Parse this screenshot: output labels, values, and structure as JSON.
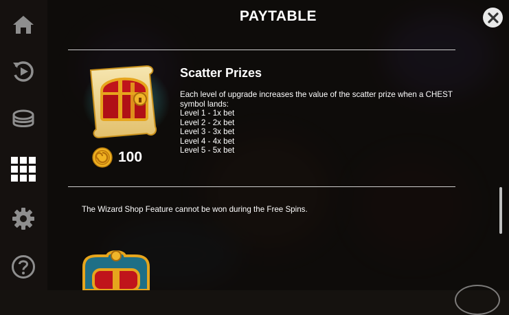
{
  "header": {
    "title": "PAYTABLE"
  },
  "sidebar": {
    "items": [
      {
        "icon": "home-icon"
      },
      {
        "icon": "autoplay-icon"
      },
      {
        "icon": "coin-stack-icon"
      },
      {
        "icon": "grid-icon",
        "active": true
      },
      {
        "icon": "gear-icon"
      },
      {
        "icon": "help-icon"
      }
    ]
  },
  "scatter": {
    "title": "Scatter Prizes",
    "description_lines": [
      "Each level of upgrade increases the value of the scatter prize when a CHEST",
      "symbol lands:",
      "Level 1 - 1x bet",
      "Level 2 - 2x bet",
      "Level 3 - 3x bet",
      "Level 4 - 4x bet",
      "Level 5 - 5x bet"
    ],
    "coin_value": "100"
  },
  "notes": {
    "wizard_shop": "The Wizard Shop Feature cannot be won during the Free Spins."
  },
  "colors": {
    "chest_red": "#c0141b",
    "gold": "#e6a51d",
    "glow": "#3fd6d3",
    "icon_grey": "#8e8e8e"
  }
}
